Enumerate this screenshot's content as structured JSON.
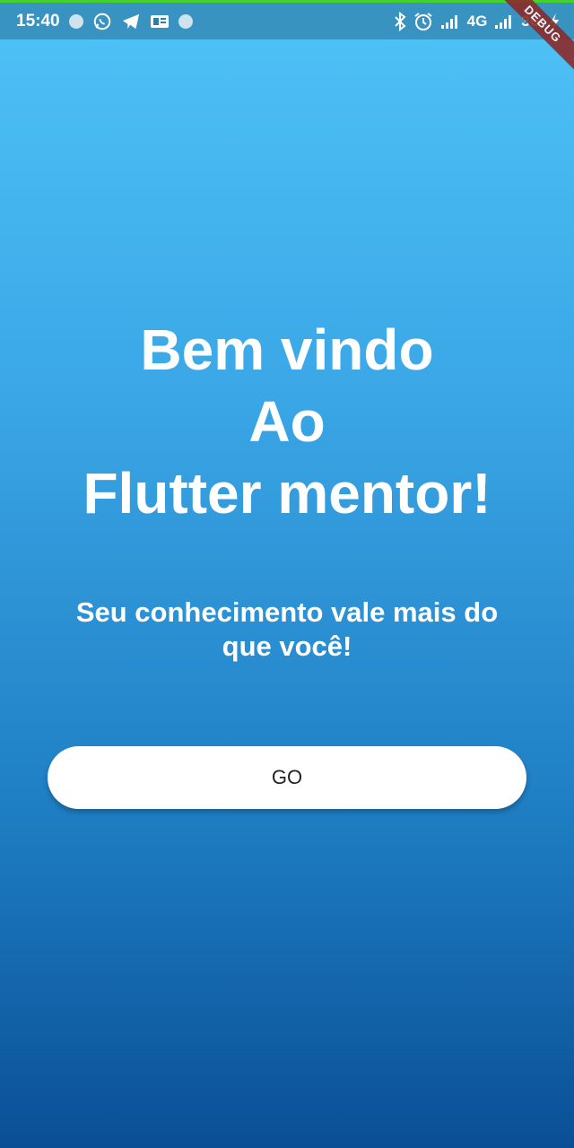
{
  "status_bar": {
    "time": "15:40",
    "network_1": "4G",
    "network_2": "3G",
    "accent_color": "#46d12a",
    "icons_left": [
      "circle-icon",
      "whatsapp-icon",
      "telegram-icon",
      "news-icon",
      "circle-icon"
    ],
    "icons_right": [
      "bluetooth-icon",
      "alarm-icon",
      "signal-icon",
      "signal-icon",
      "charging-icon"
    ]
  },
  "debug_banner": "DEBUG",
  "welcome": {
    "line1": "Bem vindo",
    "line2": "Ao",
    "line3": "Flutter mentor!"
  },
  "subtitle": "Seu conhecimento vale mais do que você!",
  "go_button": {
    "label": "GO"
  },
  "colors": {
    "gradient_top": "#4fc3f7",
    "gradient_bottom": "#0a4f96",
    "text": "#ffffff",
    "button_bg": "#ffffff"
  }
}
